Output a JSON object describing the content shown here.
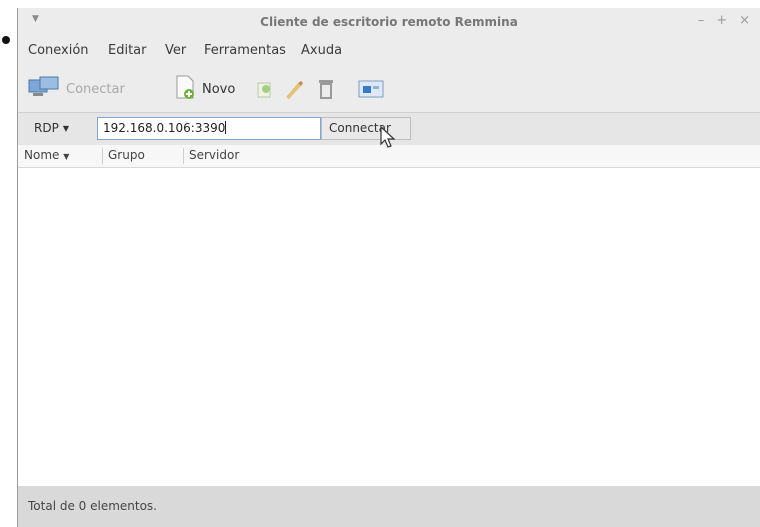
{
  "window": {
    "title": "Cliente de escritorio remoto Remmina",
    "controls": {
      "minimize": "–",
      "maximize": "+",
      "close": "×"
    }
  },
  "menu": [
    {
      "label": "Conexión"
    },
    {
      "label": "Editar"
    },
    {
      "label": "Ver"
    },
    {
      "label": "Ferramentas"
    },
    {
      "label": "Axuda"
    }
  ],
  "toolbar": {
    "connect_label": "Conectar",
    "new_label": "Novo",
    "icons": [
      "connect-icon",
      "new-icon",
      "copy-icon",
      "edit-icon",
      "delete-icon",
      "preferences-icon"
    ]
  },
  "quickconnect": {
    "protocol": "RDP",
    "server_value": "192.168.0.106:3390",
    "connect_button": "Connectar"
  },
  "table": {
    "columns": [
      {
        "label": "Nome",
        "sorted": true
      },
      {
        "label": "Grupo"
      },
      {
        "label": "Servidor"
      }
    ],
    "rows": []
  },
  "status": {
    "text": "Total de 0 elementos."
  },
  "colors": {
    "window_bg": "#ececec",
    "input_border": "#7fa7d6",
    "status_bg": "#d9d9d9",
    "accent_green": "#6bb33a",
    "accent_blue": "#3a78c9"
  }
}
